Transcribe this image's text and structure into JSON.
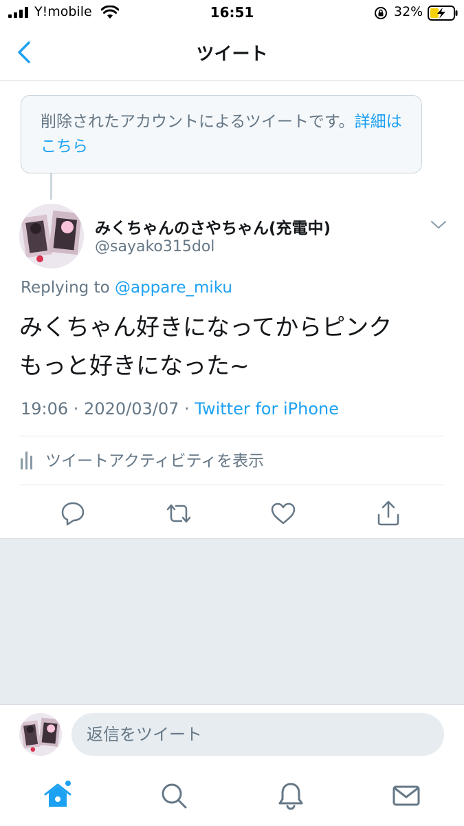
{
  "status_bar": {
    "carrier": "Y!mobile",
    "time": "16:51",
    "battery": "32%"
  },
  "nav": {
    "title": "ツイート"
  },
  "notice": {
    "text": "削除されたアカウントによるツイートです。",
    "link": "詳細はこちら"
  },
  "tweet": {
    "name": "みくちゃんのさやちゃん(充電中)",
    "handle": "@sayako315dol",
    "replying_prefix": "Replying to",
    "replying_handle": "@appare_miku",
    "text_line1": "みくちゃん好きになってからピンク",
    "text_line2": "もっと好きになった~",
    "timestamp": "19:06 · 2020/03/07 · ",
    "source": "Twitter for iPhone",
    "activity": "ツイートアクティビティを表示"
  },
  "reply": {
    "placeholder": "返信をツイート"
  },
  "colors": {
    "accent": "#1da1f2",
    "secondary": "#657786",
    "background_gray": "#e6ecf0"
  },
  "icons": {
    "actions": [
      "reply-icon",
      "retweet-icon",
      "like-icon",
      "share-icon"
    ],
    "tabs": [
      "home-icon",
      "search-icon",
      "notifications-icon",
      "messages-icon"
    ]
  }
}
